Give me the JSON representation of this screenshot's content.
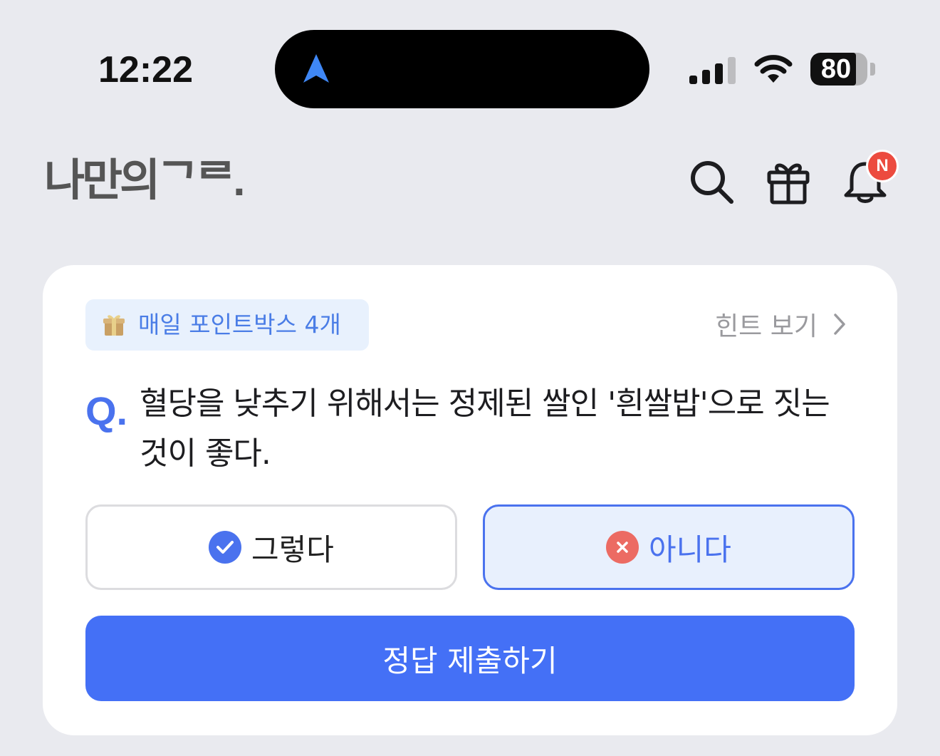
{
  "status_bar": {
    "time": "12:22",
    "battery_level": "80",
    "battery_fraction": 0.8
  },
  "header": {
    "logo": "나만의ᄀᄅ.",
    "notification_badge": "N"
  },
  "quiz": {
    "pointbox_label": "매일 포인트박스 4개",
    "hint_label": "힌트 보기",
    "q_mark": "Q.",
    "question": "혈당을 낮추기 위해서는 정제된 쌀인 '흰쌀밥'으로 짓는 것이 좋다.",
    "options": [
      {
        "label": "그렇다",
        "icon": "check-icon",
        "selected": false
      },
      {
        "label": "아니다",
        "icon": "x-icon",
        "selected": true
      }
    ],
    "submit_label": "정답 제출하기"
  },
  "colors": {
    "accent": "#4470f6",
    "selected_bg": "#e8f0fd",
    "badge_red": "#ec4b3f",
    "x_red": "#ec6b63"
  }
}
